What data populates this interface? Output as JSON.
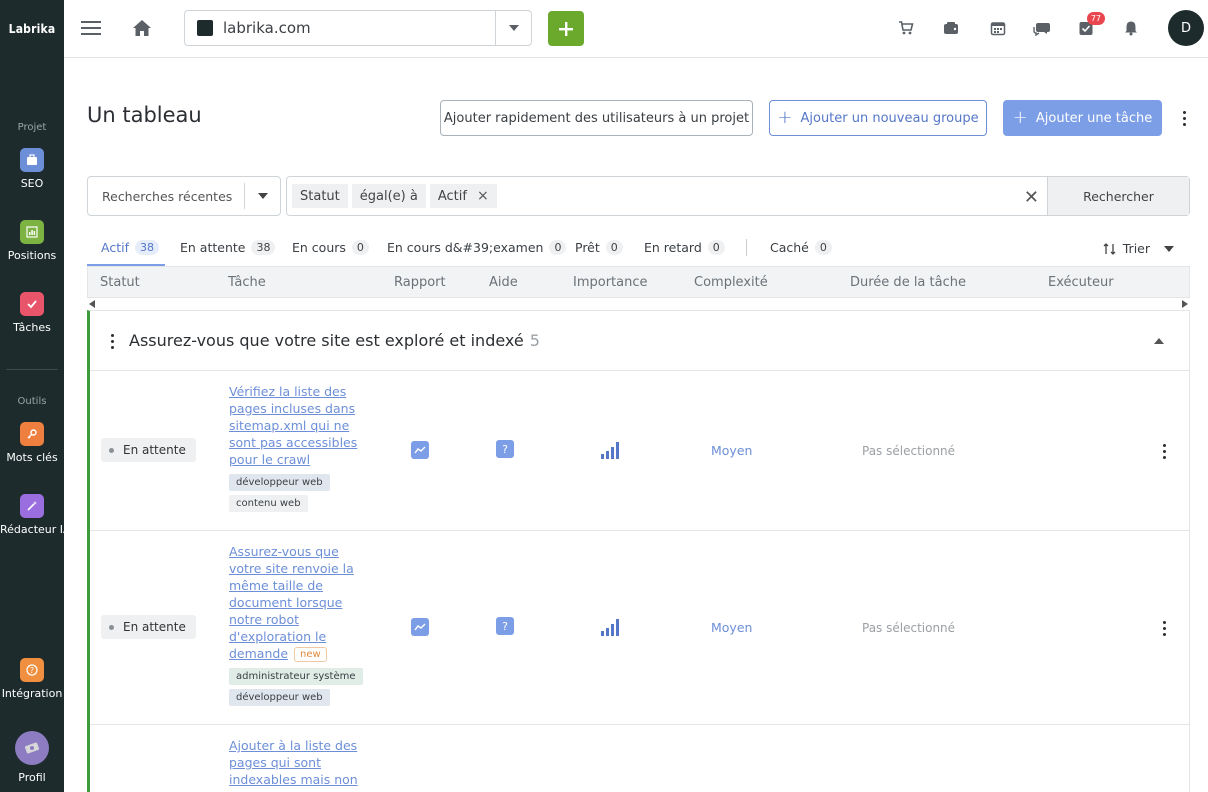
{
  "app": {
    "logo_text": "Labrika"
  },
  "sidebar": {
    "section_project": "Projet",
    "section_tools": "Outils",
    "items": [
      {
        "label": "SEO",
        "icon": "briefcase-icon",
        "color": "#6d8fd8"
      },
      {
        "label": "Positions",
        "icon": "chart-icon",
        "color": "#7cb342"
      },
      {
        "label": "Tâches",
        "icon": "check-icon",
        "color": "#e8546a"
      },
      {
        "label": "Mots clés",
        "icon": "key-icon",
        "color": "#ef7f3f"
      },
      {
        "label": "Rédacteur IA",
        "icon": "magic-wand-icon",
        "color": "#9b6ee0"
      },
      {
        "label": "Intégration",
        "icon": "question-icon",
        "color": "#ef8f3f"
      },
      {
        "label": "Profil",
        "icon": "user-avatar-icon",
        "color": "#8e7cc3"
      }
    ]
  },
  "topbar": {
    "domain": "labrika.com",
    "notifications_badge": "77",
    "avatar_initial": "D"
  },
  "header": {
    "title": "Un tableau",
    "btn_add_users": "Ajouter rapidement des utilisateurs à un projet",
    "btn_add_group": "Ajouter un nouveau groupe",
    "btn_add_task": "Ajouter une tâche"
  },
  "filters": {
    "recent_label": "Recherches récentes",
    "chips": [
      "Statut",
      "égal(e) à",
      "Actif"
    ],
    "search_button": "Rechercher"
  },
  "tabs": [
    {
      "label": "Actif",
      "count": "38"
    },
    {
      "label": "En attente",
      "count": "38"
    },
    {
      "label": "En cours",
      "count": "0"
    },
    {
      "label": "En cours d&#39;examen",
      "count": "0"
    },
    {
      "label": "Prêt",
      "count": "0"
    },
    {
      "label": "En retard",
      "count": "0"
    },
    {
      "label": "Caché",
      "count": "0"
    }
  ],
  "sort_label": "Trier",
  "table": {
    "columns": [
      "Statut",
      "Tâche",
      "Rapport",
      "Aide",
      "Importance",
      "Complexité",
      "Durée de la tâche",
      "Exécuteur"
    ],
    "group": {
      "title": "Assurez-vous que votre site est exploré et indexé",
      "count": "5"
    },
    "rows": [
      {
        "status": "En attente",
        "task": "Vérifiez la liste des pages incluses dans sitemap.xml qui ne sont pas accessibles pour le crawl",
        "tags": [
          "développeur web",
          "contenu web"
        ],
        "complexity": "Moyen",
        "duration": "Pas sélectionné"
      },
      {
        "status": "En attente",
        "task": "Assurez-vous que votre site renvoie la même taille de document lorsque notre robot d'exploration le demande",
        "new_label": "new",
        "tags": [
          "administrateur système",
          "développeur web"
        ],
        "complexity": "Moyen",
        "duration": "Pas sélectionné"
      },
      {
        "task": "Ajouter à la liste des pages qui sont indexables mais non"
      }
    ]
  }
}
